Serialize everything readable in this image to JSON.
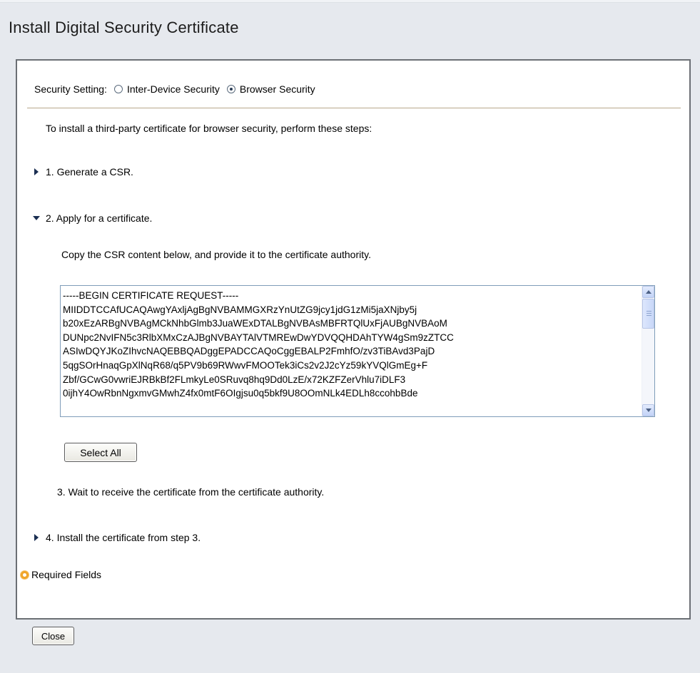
{
  "dialog": {
    "title": "Install Digital Security Certificate",
    "close_label": "Close"
  },
  "security": {
    "label": "Security Setting:",
    "options": [
      {
        "label": "Inter-Device Security",
        "selected": false
      },
      {
        "label": "Browser Security",
        "selected": true
      }
    ]
  },
  "intro": "To install a third-party certificate for browser security, perform these steps:",
  "steps": [
    {
      "label": "1. Generate a CSR.",
      "expanded": false
    },
    {
      "label": "2. Apply for a certificate.",
      "expanded": true
    },
    {
      "label": "3. Wait to receive the certificate from the certificate authority."
    },
    {
      "label": "4. Install the certificate from step 3.",
      "expanded": false
    }
  ],
  "apply": {
    "instruction": "Copy the CSR content below, and provide it to the certificate authority.",
    "csr_lines": [
      "-----BEGIN CERTIFICATE REQUEST-----",
      "MIIDDTCCAfUCAQAwgYAxljAgBgNVBAMMGXRzYnUtZG9jcy1jdG1zMi5jaXNjby5j",
      "b20xEzARBgNVBAgMCkNhbGlmb3JuaWExDTALBgNVBAsMBFRTQlUxFjAUBgNVBAoM",
      "DUNpc2NvIFN5c3RlbXMxCzAJBgNVBAYTAlVTMREwDwYDVQQHDAhTYW4gSm9zZTCC",
      "ASIwDQYJKoZIhvcNAQEBBQADggEPADCCAQoCggEBALP2FmhfO/zv3TiBAvd3PajD",
      "5qgSOrHnaqGpXlNqR68/q5PV9b69RWwvFMOOTek3iCs2v2J2cYz59kYVQlGmEg+F",
      "Zbf/GCwG0vwriEJRBkBf2FLmkyLe0SRuvq8hq9Dd0LzE/x72KZFZerVhlu7iDLF3",
      "0ijhY4OwRbnNgxmvGMwhZ4fx0mtF6OIgjsu0q5bkf9U8OOmNLk4EDLh8ccohbBde"
    ],
    "select_all_label": "Select All"
  },
  "required_fields": "Required Fields",
  "colors": {
    "background": "#e6e9ee",
    "panel_border": "#6b6f74",
    "divider": "#b9a88b",
    "required_icon": "#f0a52a",
    "triangle": "#1b2f52"
  }
}
